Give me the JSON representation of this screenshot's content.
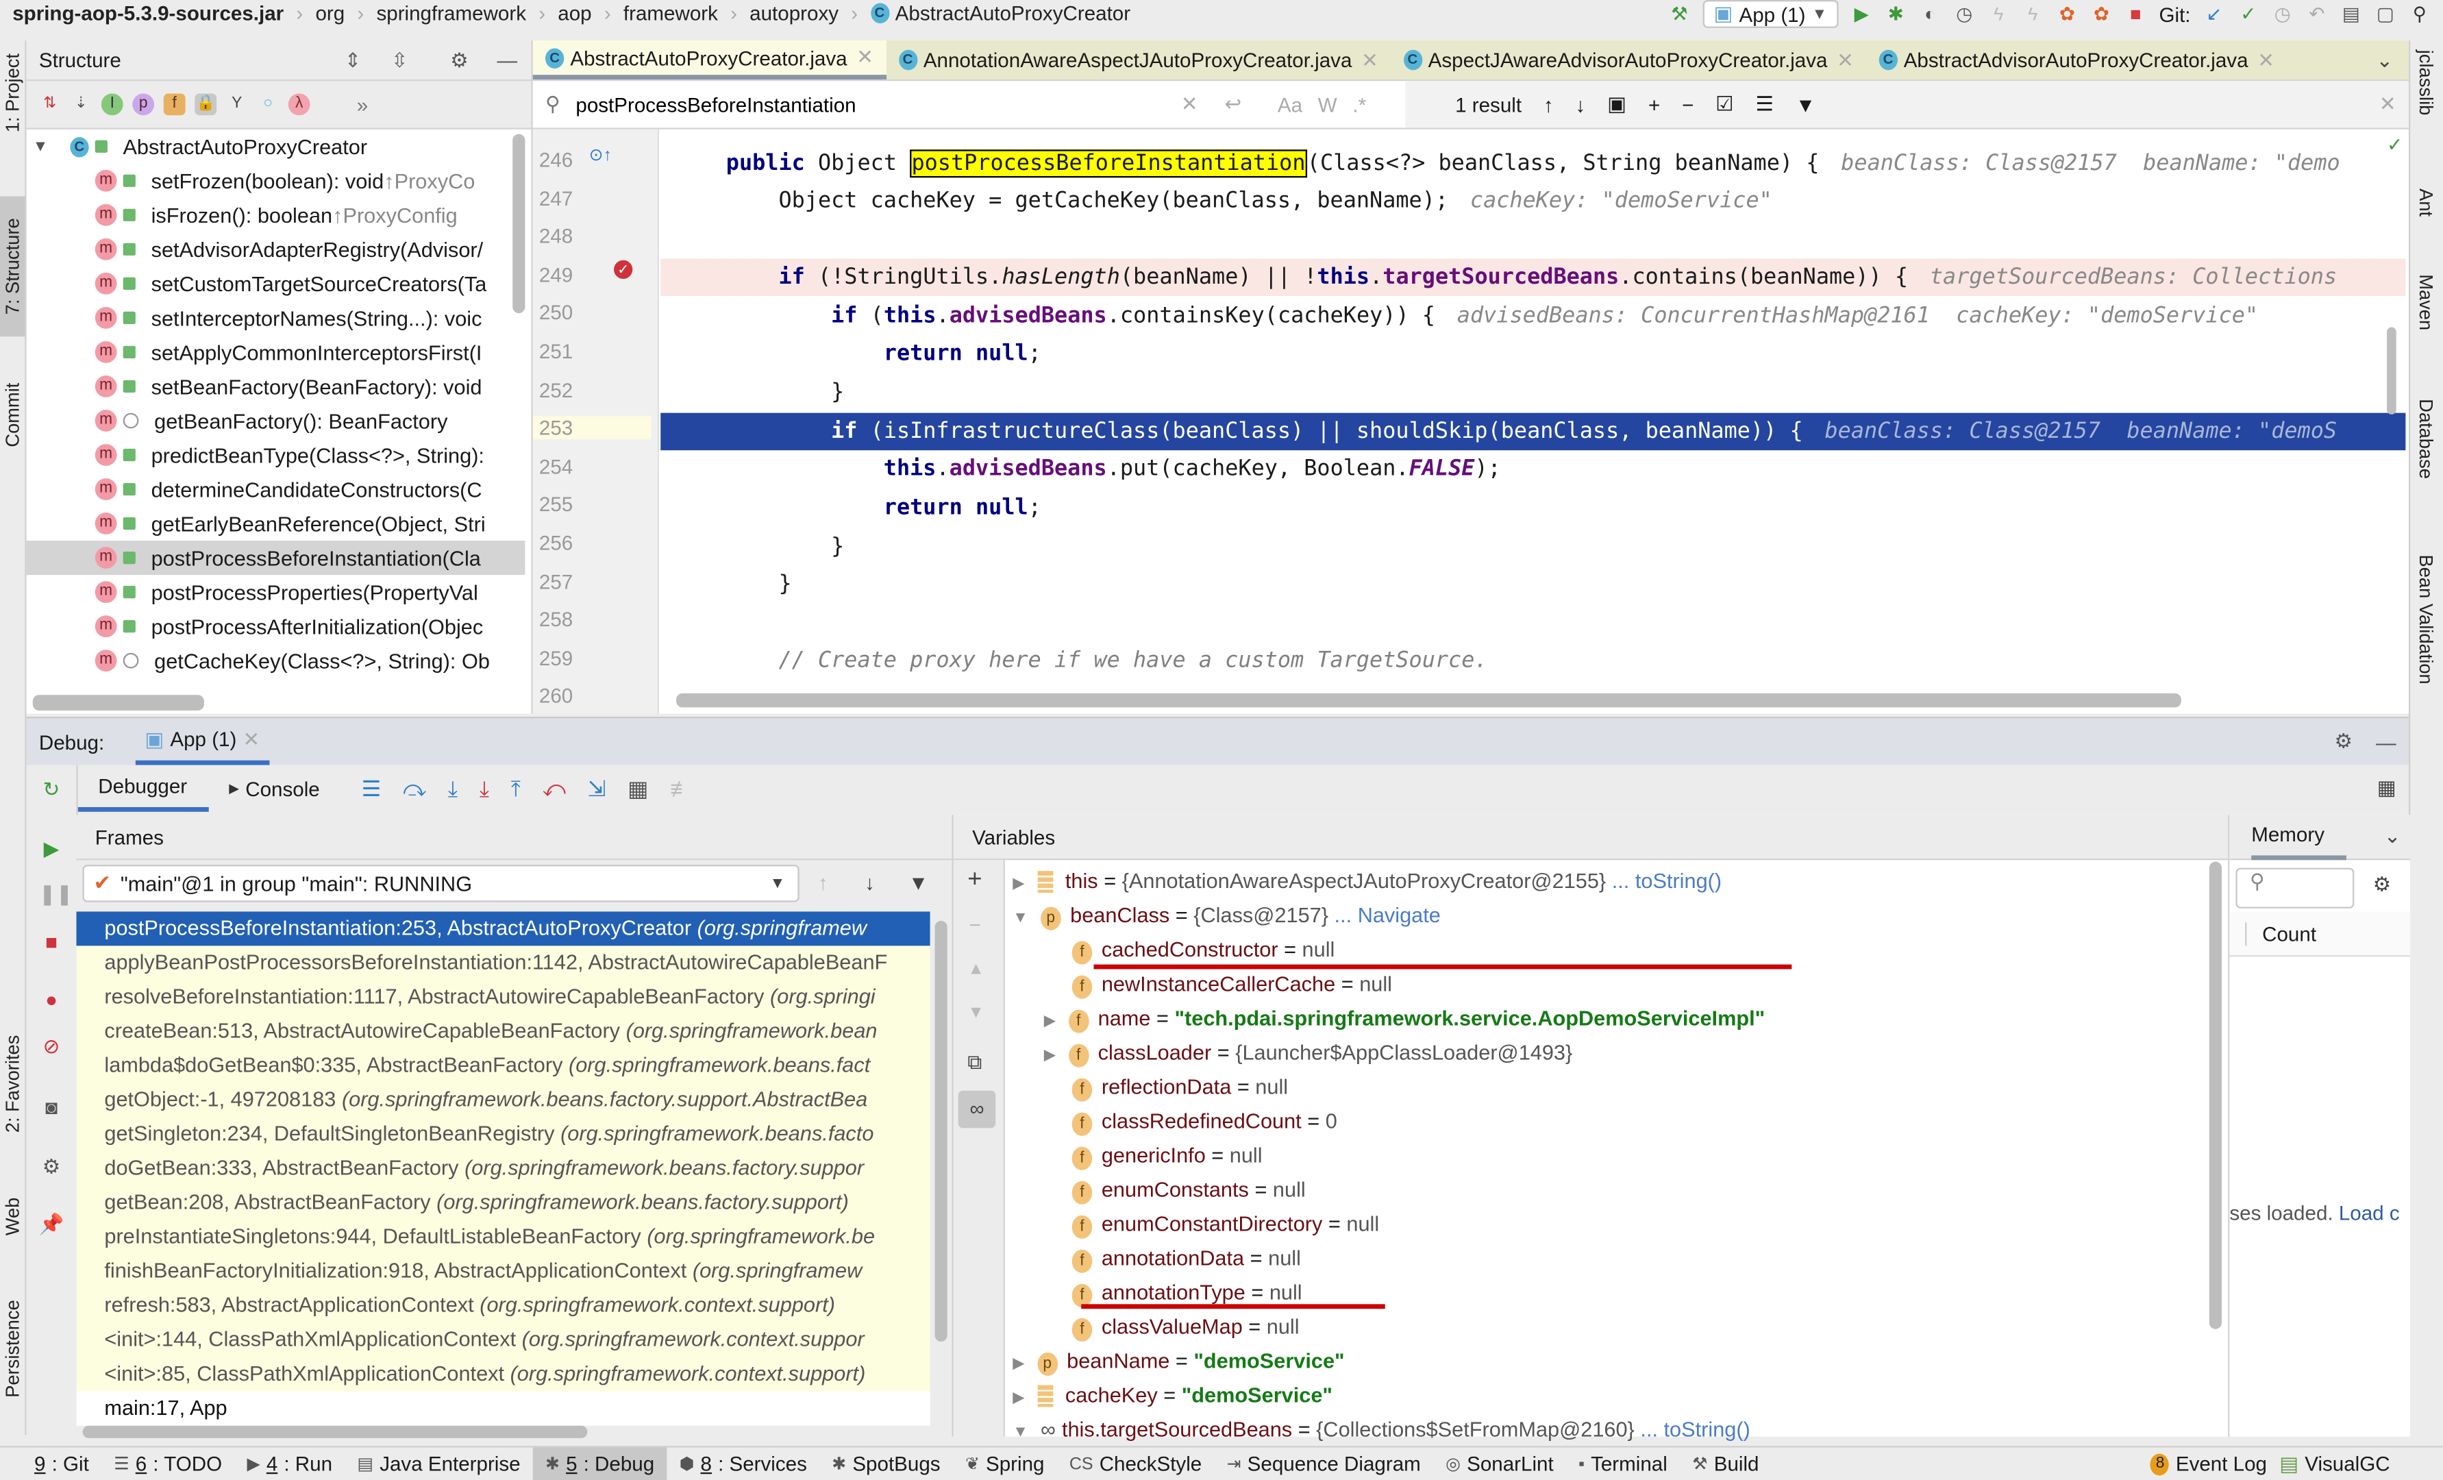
{
  "navbar": {
    "breadcrumbs": [
      "spring-aop-5.3.9-sources.jar",
      "org",
      "springframework",
      "aop",
      "framework",
      "autoproxy",
      "AbstractAutoProxyCreator"
    ],
    "run_config": "App (1)",
    "git_label": "Git:"
  },
  "left_strip": [
    "1: Project",
    "7: Structure",
    "Commit",
    "2: Favorites",
    "Web",
    "Persistence"
  ],
  "right_strip": [
    "jclasslib",
    "Ant",
    "Maven",
    "Database",
    "Bean Validation"
  ],
  "structure": {
    "title": "Structure",
    "root": "AbstractAutoProxyCreator",
    "items": [
      {
        "name": "setFrozen(boolean): void",
        "inherit": "↑ProxyCo",
        "access": "public"
      },
      {
        "name": "isFrozen(): boolean",
        "inherit": "↑ProxyConfig",
        "access": "public"
      },
      {
        "name": "setAdvisorAdapterRegistry(Advisor/",
        "inherit": "",
        "access": "public"
      },
      {
        "name": "setCustomTargetSourceCreators(Ta",
        "inherit": "",
        "access": "public"
      },
      {
        "name": "setInterceptorNames(String...): voic",
        "inherit": "",
        "access": "public"
      },
      {
        "name": "setApplyCommonInterceptorsFirst(I",
        "inherit": "",
        "access": "public"
      },
      {
        "name": "setBeanFactory(BeanFactory): void",
        "inherit": "",
        "access": "public"
      },
      {
        "name": "getBeanFactory(): BeanFactory",
        "inherit": "",
        "access": "protected"
      },
      {
        "name": "predictBeanType(Class<?>, String):",
        "inherit": "",
        "access": "public"
      },
      {
        "name": "determineCandidateConstructors(C",
        "inherit": "",
        "access": "public"
      },
      {
        "name": "getEarlyBeanReference(Object, Stri",
        "inherit": "",
        "access": "public"
      },
      {
        "name": "postProcessBeforeInstantiation(Cla",
        "inherit": "",
        "access": "public",
        "selected": true
      },
      {
        "name": "postProcessProperties(PropertyVal",
        "inherit": "",
        "access": "public"
      },
      {
        "name": "postProcessAfterInitialization(Objec",
        "inherit": "",
        "access": "public"
      },
      {
        "name": "getCacheKey(Class<?>, String): Ob",
        "inherit": "",
        "access": "protected"
      }
    ]
  },
  "editor": {
    "tabs": [
      "AbstractAutoProxyCreator.java",
      "AnnotationAwareAspectJAutoProxyCreator.java",
      "AspectJAwareAdvisorAutoProxyCreator.java",
      "AbstractAdvisorAutoProxyCreator.java"
    ],
    "active_tab": 0,
    "find": {
      "query": "postProcessBeforeInstantiation",
      "result": "1 result",
      "opt_case": "Aa",
      "opt_word": "W",
      "opt_regex": ".*"
    },
    "lines": [
      246,
      247,
      248,
      249,
      250,
      251,
      252,
      253,
      254,
      255,
      256,
      257,
      258,
      259,
      260
    ],
    "code": {
      "l246_a": "public",
      "l246_b": " Object ",
      "l246_match": "postProcessBeforeInstantiation",
      "l246_c": "(Class<?> beanClass, String beanName) {",
      "l246_hint": "beanClass: Class@2157  beanName: \"demo",
      "l247": "    Object cacheKey = getCacheKey(beanClass, beanName);",
      "l247_hint": "cacheKey: \"demoService\"",
      "l249_a": "    if",
      "l249_b": " (!StringUtils.",
      "l249_c": "hasLength",
      "l249_d": "(beanName) || !",
      "l249_e": "this",
      "l249_f": ".",
      "l249_g": "targetSourcedBeans",
      "l249_h": ".contains(beanName)) {",
      "l249_hint": "targetSourcedBeans: Collections",
      "l250_a": "        if",
      "l250_b": " (",
      "l250_c": "this",
      "l250_d": ".",
      "l250_e": "advisedBeans",
      "l250_f": ".containsKey(cacheKey)) {",
      "l250_hint": "advisedBeans: ConcurrentHashMap@2161  cacheKey: \"demoService\"",
      "l251_a": "            return null",
      "l251_b": ";",
      "l252": "        }",
      "l253_a": "        if",
      "l253_b": " (isInfrastructureClass(beanClass) || shouldSkip(beanClass, beanName)) {",
      "l253_hint": "beanClass: Class@2157  beanName: \"demoS",
      "l254_a": "            this",
      "l254_b": ".",
      "l254_c": "advisedBeans",
      "l254_d": ".put(cacheKey, Boolean.",
      "l254_e": "FALSE",
      "l254_f": ");",
      "l255_a": "            return null",
      "l255_b": ";",
      "l256": "        }",
      "l257": "    }",
      "l259": "    // Create proxy here if we have a custom TargetSource."
    }
  },
  "debug": {
    "label": "Debug:",
    "session": "App (1)",
    "tabs": [
      "Debugger",
      "Console"
    ],
    "frames_title": "Frames",
    "thread": "\"main\"@1 in group \"main\": RUNNING",
    "frames": [
      {
        "method": "postProcessBeforeInstantiation:253, AbstractAutoProxyCreator",
        "pkg": "(org.springframew"
      },
      {
        "method": "applyBeanPostProcessorsBeforeInstantiation:1142, AbstractAutowireCapableBeanF",
        "pkg": ""
      },
      {
        "method": "resolveBeforeInstantiation:1117, AbstractAutowireCapableBeanFactory",
        "pkg": "(org.springi"
      },
      {
        "method": "createBean:513, AbstractAutowireCapableBeanFactory",
        "pkg": "(org.springframework.bean"
      },
      {
        "method": "lambda$doGetBean$0:335, AbstractBeanFactory",
        "pkg": "(org.springframework.beans.fact"
      },
      {
        "method": "getObject:-1, 497208183",
        "pkg": "(org.springframework.beans.factory.support.AbstractBea"
      },
      {
        "method": "getSingleton:234, DefaultSingletonBeanRegistry",
        "pkg": "(org.springframework.beans.facto"
      },
      {
        "method": "doGetBean:333, AbstractBeanFactory",
        "pkg": "(org.springframework.beans.factory.suppor"
      },
      {
        "method": "getBean:208, AbstractBeanFactory",
        "pkg": "(org.springframework.beans.factory.support)"
      },
      {
        "method": "preInstantiateSingletons:944, DefaultListableBeanFactory",
        "pkg": "(org.springframework.be"
      },
      {
        "method": "finishBeanFactoryInitialization:918, AbstractApplicationContext",
        "pkg": "(org.springframew"
      },
      {
        "method": "refresh:583, AbstractApplicationContext",
        "pkg": "(org.springframework.context.support)"
      },
      {
        "method": "<init>:144, ClassPathXmlApplicationContext",
        "pkg": "(org.springframework.context.suppor"
      },
      {
        "method": "<init>:85, ClassPathXmlApplicationContext",
        "pkg": "(org.springframework.context.support)"
      },
      {
        "method": "main:17, App",
        "pkg": ""
      }
    ],
    "variables_title": "Variables",
    "variables": [
      {
        "name": "this",
        "value": "{AnnotationAwareAspectJAutoProxyCreator@2155}",
        "link": "... toString()",
        "kind": "local",
        "depth": 0,
        "expand": "collapsed"
      },
      {
        "name": "beanClass",
        "value": "{Class@2157}",
        "link": "... Navigate",
        "kind": "p",
        "depth": 0,
        "expand": "expanded"
      },
      {
        "name": "cachedConstructor",
        "value": "null",
        "kind": "f",
        "depth": 1
      },
      {
        "name": "newInstanceCallerCache",
        "value": "null",
        "kind": "f",
        "depth": 1
      },
      {
        "name": "name",
        "value": "\"tech.pdai.springframework.service.AopDemoServiceImpl\"",
        "kind": "f",
        "depth": 1,
        "expand": "collapsed",
        "string": true
      },
      {
        "name": "classLoader",
        "value": "{Launcher$AppClassLoader@1493}",
        "kind": "f",
        "depth": 1,
        "expand": "collapsed"
      },
      {
        "name": "reflectionData",
        "value": "null",
        "kind": "f",
        "depth": 1
      },
      {
        "name": "classRedefinedCount",
        "value": "0",
        "kind": "f",
        "depth": 1
      },
      {
        "name": "genericInfo",
        "value": "null",
        "kind": "f",
        "depth": 1
      },
      {
        "name": "enumConstants",
        "value": "null",
        "kind": "f",
        "depth": 1
      },
      {
        "name": "enumConstantDirectory",
        "value": "null",
        "kind": "f",
        "depth": 1
      },
      {
        "name": "annotationData",
        "value": "null",
        "kind": "f",
        "depth": 1
      },
      {
        "name": "annotationType",
        "value": "null",
        "kind": "f",
        "depth": 1
      },
      {
        "name": "classValueMap",
        "value": "null",
        "kind": "f",
        "depth": 1
      },
      {
        "name": "beanName",
        "value": "\"demoService\"",
        "kind": "p",
        "depth": 0,
        "expand": "collapsed",
        "string": true
      },
      {
        "name": "cacheKey",
        "value": "\"demoService\"",
        "kind": "local",
        "depth": 0,
        "expand": "collapsed",
        "string": true
      },
      {
        "name": "this.targetSourcedBeans",
        "value": "{Collections$SetFromMap@2160}",
        "link": "... toString()",
        "kind": "watch",
        "depth": 0,
        "expand": "expanded"
      }
    ],
    "memory": {
      "title": "Memory",
      "column": "Count",
      "status": "ses loaded.",
      "load_link": "Load c"
    }
  },
  "bottom_bar": [
    {
      "num": "9",
      "label": ": Git"
    },
    {
      "num": "6",
      "label": ": TODO"
    },
    {
      "num": "4",
      "label": ": Run"
    },
    {
      "num": "",
      "label": "Java Enterprise"
    },
    {
      "num": "5",
      "label": ": Debug",
      "active": true
    },
    {
      "num": "8",
      "label": ": Services"
    },
    {
      "num": "",
      "label": "SpotBugs"
    },
    {
      "num": "",
      "label": "Spring"
    },
    {
      "num": "",
      "label": "CheckStyle"
    },
    {
      "num": "",
      "label": "Sequence Diagram"
    },
    {
      "num": "",
      "label": "SonarLint"
    },
    {
      "num": "",
      "label": "Terminal"
    },
    {
      "num": "",
      "label": "Build"
    }
  ],
  "event_log": {
    "badge": "8",
    "label": "Event Log"
  },
  "visualgc": "VisualGC"
}
